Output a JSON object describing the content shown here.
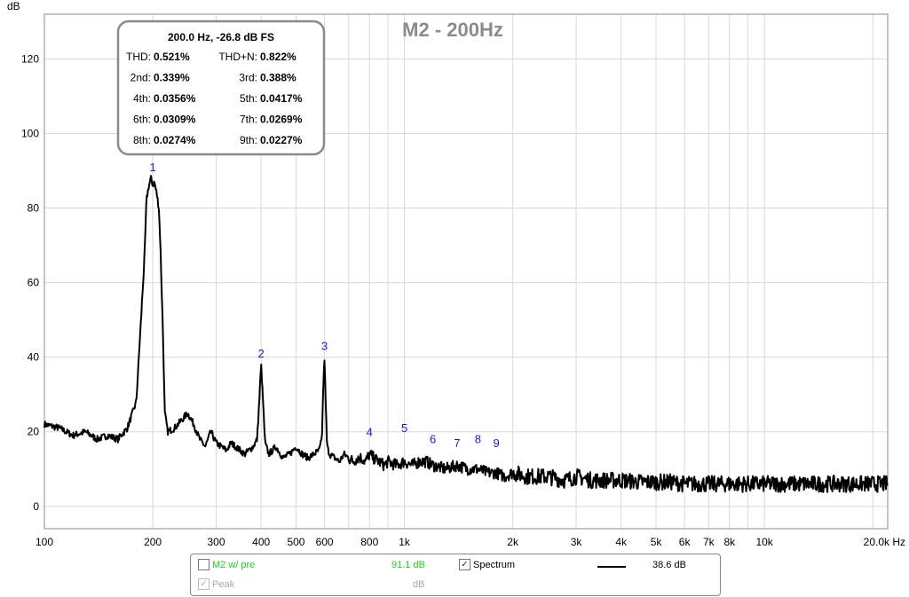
{
  "chart_data": {
    "type": "line",
    "title": "M2 - 200Hz",
    "ylabel": "dB",
    "xscale": "log",
    "xlim": [
      100,
      22000
    ],
    "ylim": [
      -6,
      132
    ],
    "grid": true,
    "x_tick_labels": [
      "100",
      "200",
      "300",
      "400",
      "500",
      "600",
      "800",
      "1k",
      "2k",
      "3k",
      "4k",
      "5k",
      "6k",
      "7k",
      "8k",
      "10k",
      "20.0k Hz"
    ],
    "x_tick_values": [
      100,
      200,
      300,
      400,
      500,
      600,
      800,
      1000,
      2000,
      3000,
      4000,
      5000,
      6000,
      7000,
      8000,
      10000,
      20000
    ],
    "y_tick_values": [
      0,
      20,
      40,
      60,
      80,
      100,
      120
    ],
    "series": [
      {
        "name": "Spectrum",
        "color": "#000000",
        "x": [
          100,
          110,
          120,
          130,
          140,
          150,
          160,
          170,
          180,
          185,
          190,
          192,
          195,
          198,
          200,
          202,
          205,
          208,
          210,
          213,
          216,
          220,
          230,
          240,
          250,
          260,
          270,
          280,
          290,
          300,
          310,
          320,
          330,
          340,
          350,
          360,
          370,
          380,
          390,
          395,
          400,
          405,
          410,
          420,
          440,
          460,
          480,
          500,
          520,
          540,
          560,
          580,
          590,
          595,
          600,
          605,
          610,
          620,
          640,
          660,
          680,
          700,
          720,
          740,
          760,
          780,
          800,
          820,
          850,
          880,
          900,
          950,
          1000,
          1050,
          1100,
          1150,
          1200,
          1300,
          1400,
          1500,
          1600,
          1700,
          1800,
          1900,
          2000,
          2200,
          2500,
          2800,
          3000,
          3300,
          3600,
          4000,
          4500,
          5000,
          5500,
          6000,
          7000,
          8000,
          9000,
          10000,
          12000,
          14000,
          16000,
          18000,
          20000,
          22000
        ],
        "y": [
          22,
          21,
          19,
          20,
          18,
          19,
          18,
          21,
          28,
          48,
          68,
          82,
          86,
          88,
          86,
          87,
          84,
          80,
          70,
          50,
          25,
          20,
          21,
          23,
          25,
          22,
          18,
          16,
          20,
          17,
          16,
          15,
          17,
          16,
          15,
          14,
          15,
          16,
          18,
          28,
          38,
          28,
          17,
          14,
          16,
          13,
          14,
          16,
          14,
          13,
          14,
          15,
          18,
          32,
          40,
          26,
          16,
          14,
          13,
          12,
          14,
          13,
          12,
          13,
          13,
          12,
          14,
          13,
          12,
          11,
          12,
          11,
          12,
          11,
          12,
          12,
          11,
          10,
          11,
          10,
          10,
          9,
          9,
          8,
          9,
          8,
          8,
          7,
          8,
          7,
          7,
          7,
          6.5,
          6.5,
          6.5,
          6,
          6,
          6,
          6,
          6,
          6,
          6,
          6,
          6,
          6,
          6
        ]
      }
    ],
    "harmonic_markers": [
      {
        "label": "1",
        "freq": 200,
        "db": 88
      },
      {
        "label": "2",
        "freq": 400,
        "db": 38
      },
      {
        "label": "3",
        "freq": 600,
        "db": 40
      },
      {
        "label": "4",
        "freq": 800,
        "db": 17
      },
      {
        "label": "5",
        "freq": 1000,
        "db": 18
      },
      {
        "label": "6",
        "freq": 1200,
        "db": 15
      },
      {
        "label": "7",
        "freq": 1400,
        "db": 14
      },
      {
        "label": "8",
        "freq": 1600,
        "db": 15
      },
      {
        "label": "9",
        "freq": 1800,
        "db": 14
      }
    ]
  },
  "thd_box": {
    "header": "200.0 Hz, -26.8 dB FS",
    "rows": [
      {
        "l_label": "THD:",
        "l_val": "0.521%",
        "r_label": "THD+N:",
        "r_val": "0.822%"
      },
      {
        "l_label": "2nd:",
        "l_val": "0.339%",
        "r_label": "3rd:",
        "r_val": "0.388%"
      },
      {
        "l_label": "4th:",
        "l_val": "0.0356%",
        "r_label": "5th:",
        "r_val": "0.0417%"
      },
      {
        "l_label": "6th:",
        "l_val": "0.0309%",
        "r_label": "7th:",
        "r_val": "0.0269%"
      },
      {
        "l_label": "8th:",
        "l_val": "0.0274%",
        "r_label": "9th:",
        "r_val": "0.0227%"
      }
    ]
  },
  "legend": {
    "m2": {
      "label": "M2 w/ pre",
      "value": "91.1 dB",
      "checked": false,
      "color": "#22cc22"
    },
    "peak": {
      "label": "Peak",
      "value": "dB",
      "checked": true,
      "disabled": true
    },
    "spectrum": {
      "label": "Spectrum",
      "value": "38.6 dB",
      "checked": true
    }
  }
}
